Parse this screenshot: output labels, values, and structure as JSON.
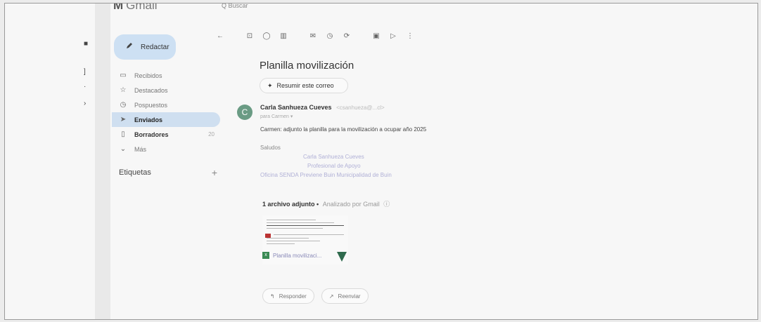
{
  "app": {
    "name": "Gmail",
    "search_text": "Q  Buscar"
  },
  "compose": {
    "label": "Redactar"
  },
  "nav": [
    {
      "label": "Recibidos",
      "icon": "inbox-icon",
      "glyph": "▭"
    },
    {
      "label": "Destacados",
      "icon": "star-icon",
      "glyph": "☆"
    },
    {
      "label": "Pospuestos",
      "icon": "clock-icon",
      "glyph": "◷"
    },
    {
      "label": "Enviados",
      "icon": "send-icon",
      "glyph": "➤"
    },
    {
      "label": "Borradores",
      "icon": "draft-icon",
      "glyph": "▯",
      "count": "20"
    },
    {
      "label": "Más",
      "icon": "chevron-down-icon",
      "glyph": "⌄"
    }
  ],
  "labels": {
    "title": "Etiquetas"
  },
  "email": {
    "subject": "Planilla movilización",
    "summarize": "Resumir este correo",
    "sender_name": "Carla Sanhueza Cueves",
    "sender_email": "<csanhueza@...cl>",
    "to_line": "para Carmen",
    "avatar_letter": "C",
    "body": "Carmen: adjunto la planilla para la movilización a ocupar año 2025",
    "greeting": "Saludos",
    "signature": [
      "Carla Sanhueza Cueves",
      "Profesional de Apoyo",
      "Oficina SENDA Previene Buin Municipalidad de Buin"
    ],
    "attachments_label": "1 archivo adjunto",
    "scanned": "Analizado por Gmail",
    "attachment_name": "Planilla movilizaci..."
  },
  "actions": {
    "reply": "Responder",
    "forward": "Reenviar"
  },
  "colors": {
    "active_nav": "#cfdff0",
    "compose_bg": "#cde0f3",
    "avatar": "#6a9b84",
    "sheet": "#3a8a54"
  }
}
